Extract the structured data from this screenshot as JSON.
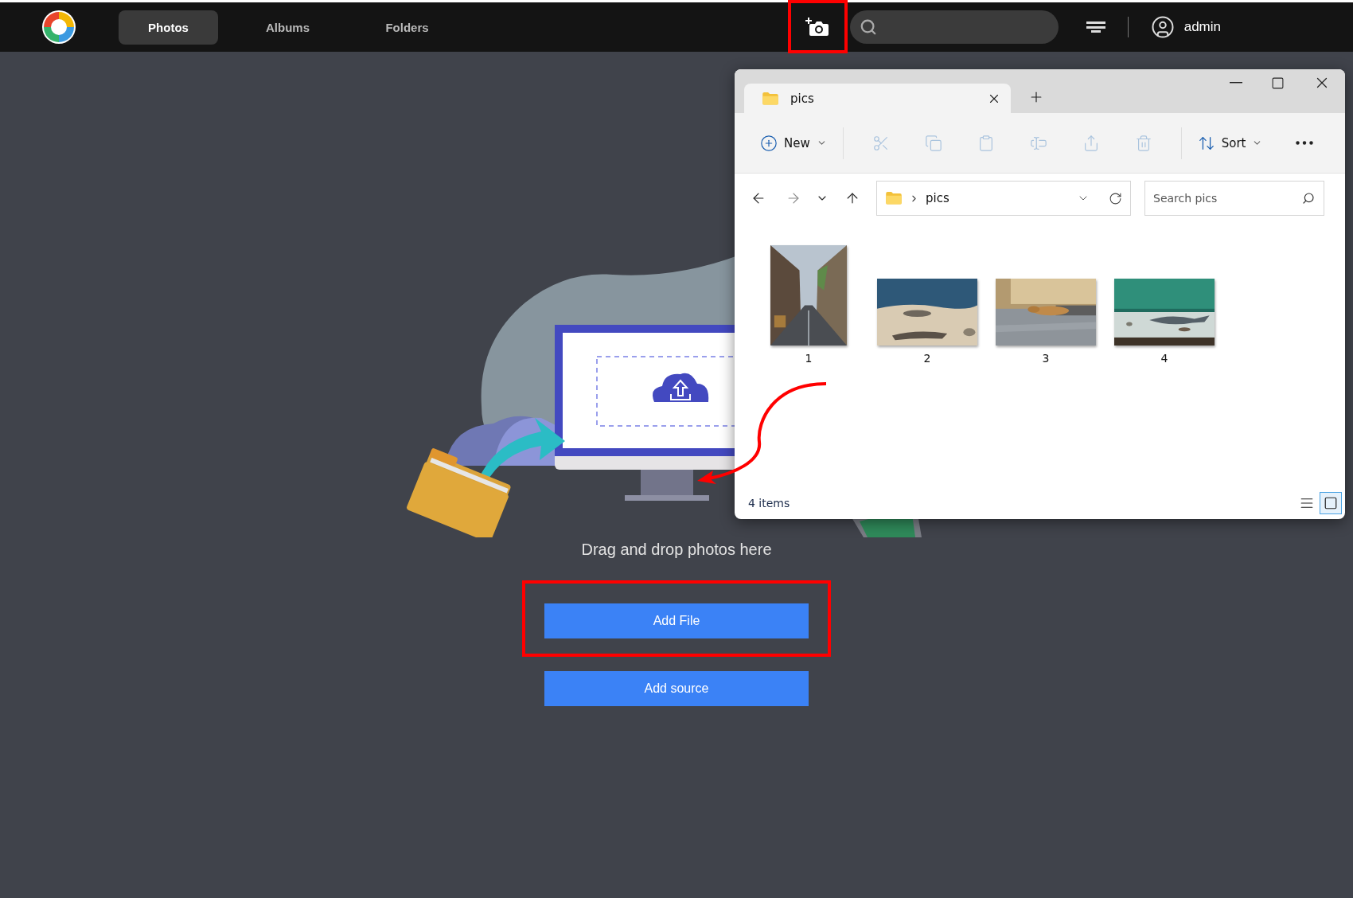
{
  "navbar": {
    "tabs": [
      {
        "label": "Photos",
        "selected": true
      },
      {
        "label": "Albums",
        "selected": false
      },
      {
        "label": "Folders",
        "selected": false
      }
    ],
    "user": {
      "name": "admin"
    }
  },
  "upload": {
    "prompt": "Drag and drop photos here",
    "buttons": [
      "Add File",
      "Add source"
    ]
  },
  "explorer": {
    "tab_title": "pics",
    "toolbar": {
      "new_label": "New",
      "sort_label": "Sort",
      "actions": [
        {
          "kind": "cut",
          "disabled": true
        },
        {
          "kind": "copy",
          "disabled": true
        },
        {
          "kind": "paste",
          "disabled": true
        },
        {
          "kind": "rename",
          "disabled": true
        },
        {
          "kind": "share",
          "disabled": true
        },
        {
          "kind": "delete",
          "disabled": true
        }
      ]
    },
    "address": {
      "crumbs": [
        "pics"
      ]
    },
    "search": {
      "placeholder": "Search pics"
    },
    "files": [
      {
        "name": "1"
      },
      {
        "name": "2"
      },
      {
        "name": "3"
      },
      {
        "name": "4"
      }
    ],
    "status": "4 items",
    "view_modes": [
      {
        "kind": "details",
        "selected": false
      },
      {
        "kind": "large-icons",
        "selected": true
      }
    ]
  }
}
